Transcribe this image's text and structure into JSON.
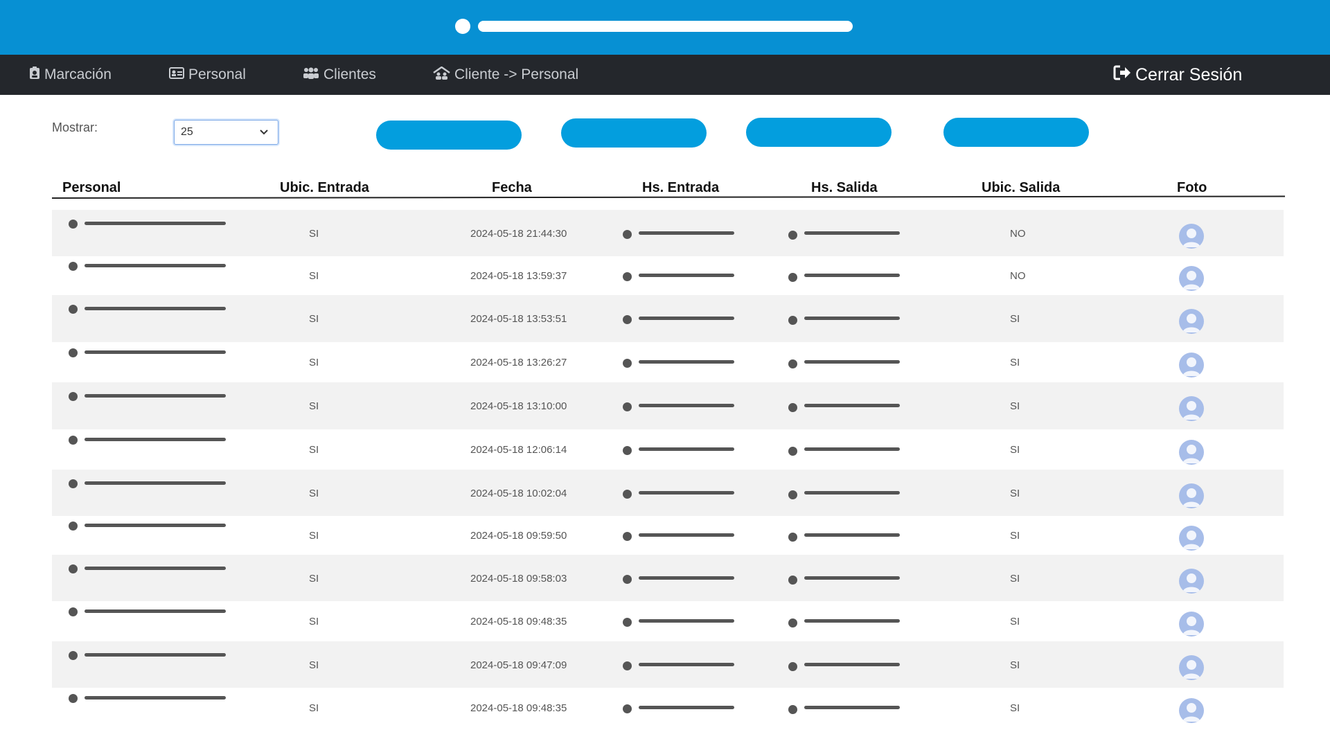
{
  "nav": {
    "items": [
      {
        "label": "Marcación",
        "icon": "id-badge-icon"
      },
      {
        "label": "Personal",
        "icon": "id-card-icon"
      },
      {
        "label": "Clientes",
        "icon": "users-icon"
      },
      {
        "label": "Cliente -> Personal",
        "icon": "house-users-icon"
      }
    ],
    "logout_label": "Cerrar Sesión",
    "logout_icon": "sign-out-icon"
  },
  "toolbar": {
    "show_label": "Mostrar:",
    "page_size": "25"
  },
  "table": {
    "headers": {
      "personal": "Personal",
      "ubic_entrada": "Ubic. Entrada",
      "fecha": "Fecha",
      "hs_entrada": "Hs. Entrada",
      "hs_salida": "Hs. Salida",
      "ubic_salida": "Ubic. Salida",
      "foto": "Foto"
    },
    "rows": [
      {
        "ubic_entrada": "SI",
        "fecha": "2024-05-18 21:44:30",
        "ubic_salida": "NO"
      },
      {
        "ubic_entrada": "SI",
        "fecha": "2024-05-18 13:59:37",
        "ubic_salida": "NO"
      },
      {
        "ubic_entrada": "SI",
        "fecha": "2024-05-18 13:53:51",
        "ubic_salida": "SI"
      },
      {
        "ubic_entrada": "SI",
        "fecha": "2024-05-18 13:26:27",
        "ubic_salida": "SI"
      },
      {
        "ubic_entrada": "SI",
        "fecha": "2024-05-18 13:10:00",
        "ubic_salida": "SI"
      },
      {
        "ubic_entrada": "SI",
        "fecha": "2024-05-18 12:06:14",
        "ubic_salida": "SI"
      },
      {
        "ubic_entrada": "SI",
        "fecha": "2024-05-18 10:02:04",
        "ubic_salida": "SI"
      },
      {
        "ubic_entrada": "SI",
        "fecha": "2024-05-18 09:59:50",
        "ubic_salida": "SI"
      },
      {
        "ubic_entrada": "SI",
        "fecha": "2024-05-18 09:58:03",
        "ubic_salida": "SI"
      },
      {
        "ubic_entrada": "SI",
        "fecha": "2024-05-18 09:48:35",
        "ubic_salida": "SI"
      },
      {
        "ubic_entrada": "SI",
        "fecha": "2024-05-18 09:47:09",
        "ubic_salida": "SI"
      },
      {
        "ubic_entrada": "SI",
        "fecha": "2024-05-18 09:48:35",
        "ubic_salida": "SI"
      }
    ]
  },
  "colors": {
    "banner": "#0790d3",
    "nav": "#24272c",
    "accent_button": "#039ede",
    "row_shade": "#f2f2f2",
    "avatar": "#a7bde9"
  }
}
